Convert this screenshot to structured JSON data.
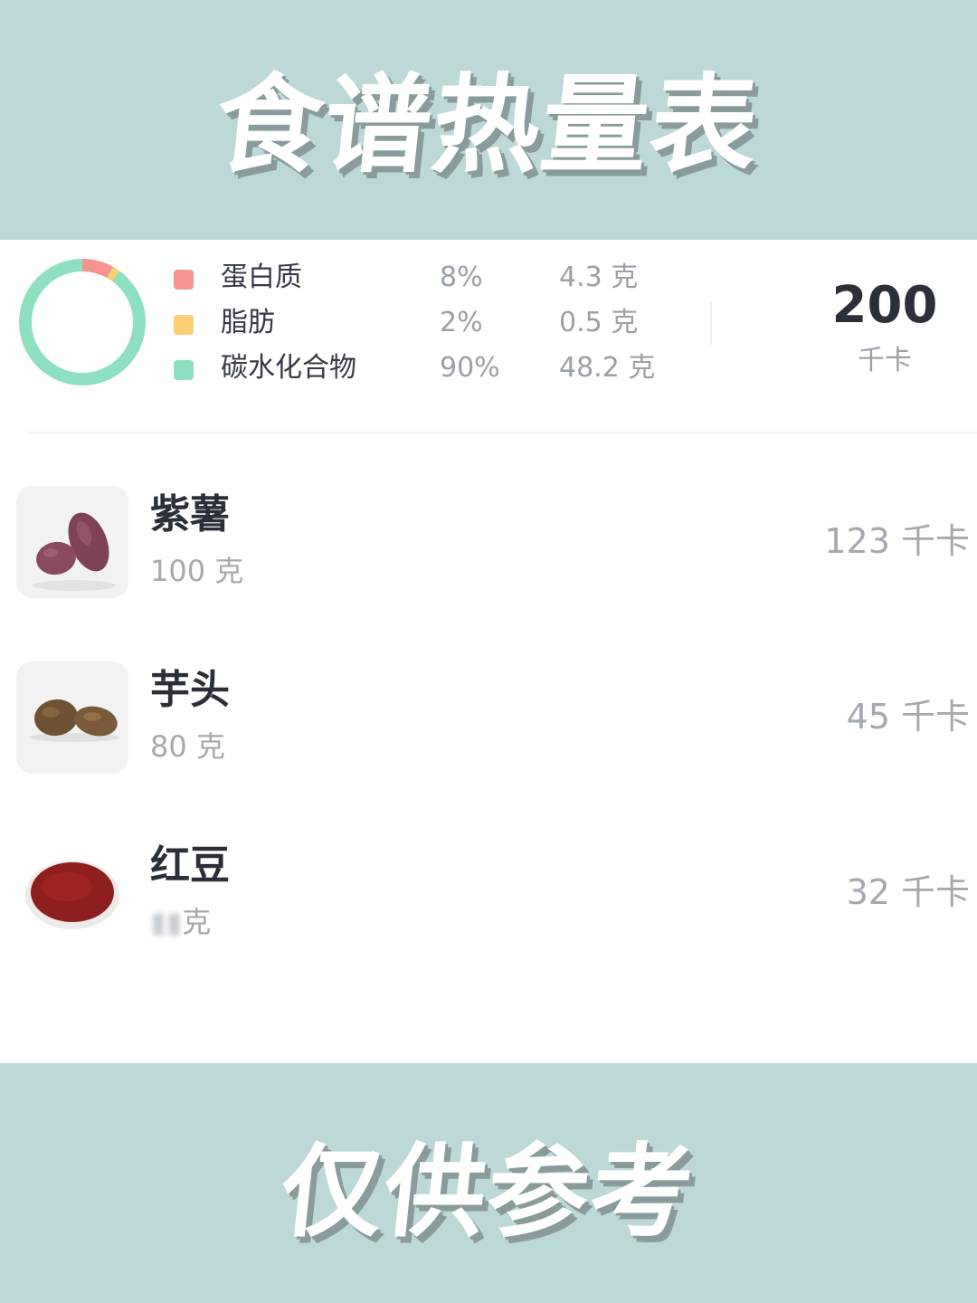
{
  "header": {
    "title": "食谱热量表"
  },
  "footer": {
    "title": "仅供参考"
  },
  "summary": {
    "total_value": "200",
    "total_unit": "千卡",
    "nutrients": [
      {
        "name": "蛋白质",
        "percent": "8%",
        "amount": "4.3 克",
        "color": "#f4938f"
      },
      {
        "name": "脂肪",
        "percent": "2%",
        "amount": "0.5 克",
        "color": "#fbcf73"
      },
      {
        "name": "碳水化合物",
        "percent": "90%",
        "amount": "48.2 克",
        "color": "#8fe0c1"
      }
    ]
  },
  "foods": [
    {
      "name": "紫薯",
      "weight": "100 克",
      "calories": "123 千卡",
      "icon": "purple-sweet-potato"
    },
    {
      "name": "芋头",
      "weight": "80 克",
      "calories": "45 千卡",
      "icon": "taro"
    },
    {
      "name": "红豆",
      "weight": "克",
      "calories": "32 千卡",
      "icon": "red-beans"
    }
  ]
}
